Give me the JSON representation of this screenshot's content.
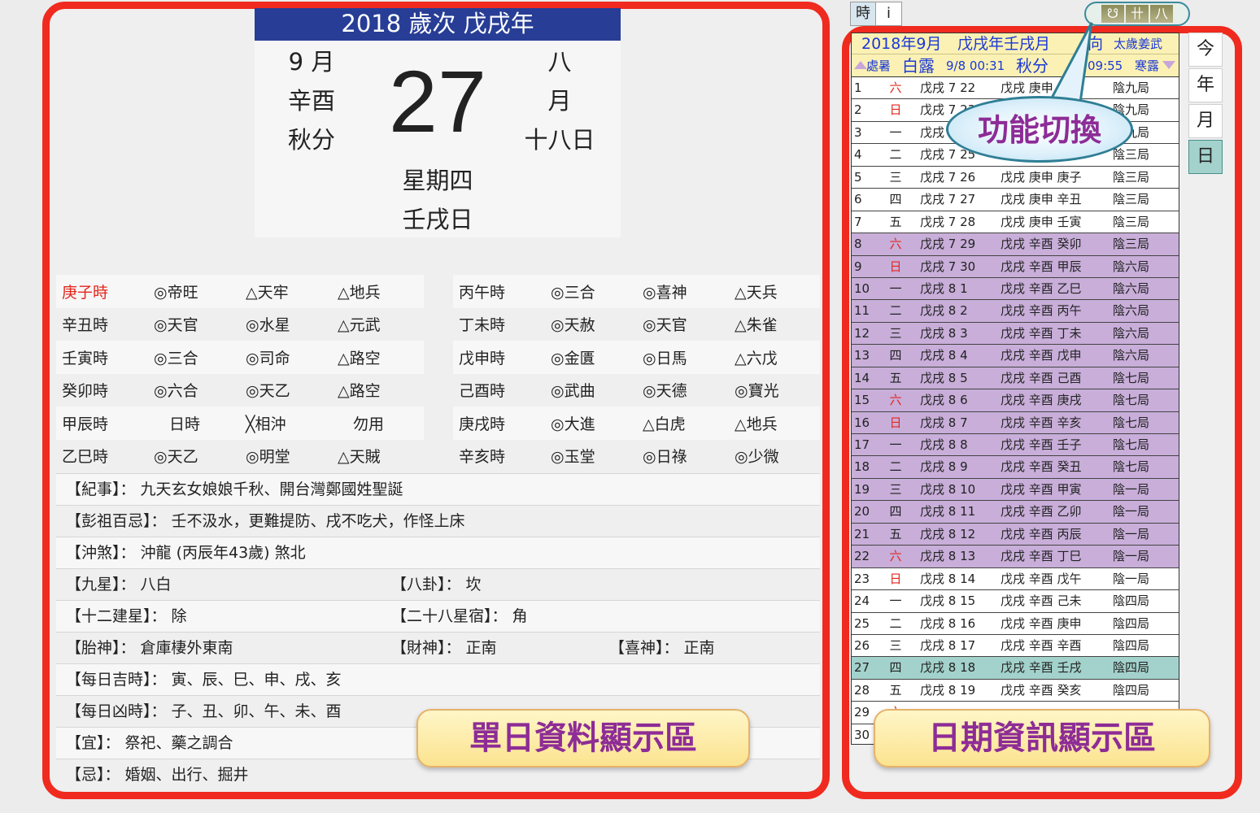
{
  "day_card": {
    "header": "2018 歲次 戊戌年",
    "greg_month": "9 月",
    "month_ganzhi": "辛酉",
    "solar_term": "秋分",
    "day": "27",
    "lunar_month_1": "八",
    "lunar_month_2": "月",
    "lunar_day": "十八日",
    "weekday": "星期四",
    "day_ganzhi": "壬戌日"
  },
  "hours_left": [
    [
      "庚子時",
      "◎帝旺",
      "△天牢",
      "△地兵"
    ],
    [
      "辛丑時",
      "◎天官",
      "◎水星",
      "△元武"
    ],
    [
      "壬寅時",
      "◎三合",
      "◎司命",
      "△路空"
    ],
    [
      "癸卯時",
      "◎六合",
      "◎天乙",
      "△路空"
    ],
    [
      "甲辰時",
      "　日時",
      "╳相沖",
      "　勿用"
    ],
    [
      "乙巳時",
      "◎天乙",
      "◎明堂",
      "△天賊"
    ]
  ],
  "hours_right": [
    [
      "丙午時",
      "◎三合",
      "◎喜神",
      "△天兵"
    ],
    [
      "丁未時",
      "◎天赦",
      "◎天官",
      "△朱雀"
    ],
    [
      "戊申時",
      "◎金匱",
      "◎日馬",
      "△六戊"
    ],
    [
      "己酉時",
      "◎武曲",
      "◎天德",
      "◎寶光"
    ],
    [
      "庚戌時",
      "◎大進",
      "△白虎",
      "△地兵"
    ],
    [
      "辛亥時",
      "◎玉堂",
      "◎日祿",
      "◎少微"
    ]
  ],
  "info": [
    [
      "【紀事】： 九天玄女娘娘千秋、開台灣鄭國姓聖誕",
      "",
      ""
    ],
    [
      "【彭祖百忌】： 壬不汲水，更難提防、戌不吃犬，作怪上床",
      "",
      ""
    ],
    [
      "【沖煞】： 沖龍 (丙辰年43歲) 煞北",
      "",
      ""
    ],
    [
      "【九星】： 八白",
      "【八卦】： 坎",
      ""
    ],
    [
      "【十二建星】： 除",
      "【二十八星宿】： 角",
      ""
    ],
    [
      "【胎神】： 倉庫棲外東南",
      "【財神】： 正南",
      "【喜神】： 正南"
    ],
    [
      "【每日吉時】： 寅、辰、巳、申、戌、亥",
      "",
      ""
    ],
    [
      "【每日凶時】： 子、丑、卯、午、未、酉",
      "",
      ""
    ],
    [
      "【宜】： 祭祀、藥之調合",
      "",
      ""
    ],
    [
      "【忌】： 婚姻、出行、掘井",
      "",
      ""
    ]
  ],
  "labels": {
    "left_area": "單日資料顯示區",
    "right_area": "日期資訊顯示區",
    "callout": "功能切換"
  },
  "top_buttons": [
    "時",
    "i"
  ],
  "icon_pill": [
    "☋",
    "卄",
    "八"
  ],
  "side_buttons": [
    "今",
    "年",
    "月",
    "日"
  ],
  "month_header": {
    "line1_a": "2018年9月",
    "line1_b": "戊戌年壬戌月",
    "line1_c": "向",
    "line1_d": "太歲姜武",
    "line2_a": "處暑",
    "line2_b": "白露",
    "line2_c": "9/8 00:31",
    "line2_d": "秋分",
    "line2_e": "09:55",
    "line2_f": "寒露"
  },
  "month_rows": [
    {
      "d": "1",
      "w": "六",
      "l": "戊戌 7 22",
      "g": "戊戌 庚申 庚辰",
      "j": "陰九局",
      "bg": "white",
      "red": true
    },
    {
      "d": "2",
      "w": "日",
      "l": "戊戌 7 23",
      "g": "戊戌 庚申 辛巳",
      "j": "陰九局",
      "bg": "white",
      "red": true
    },
    {
      "d": "3",
      "w": "一",
      "l": "戊戌 7 24",
      "g": "戊戌 庚申 壬午",
      "j": "陰九局",
      "bg": "white",
      "red": false
    },
    {
      "d": "4",
      "w": "二",
      "l": "戊戌 7 25",
      "g": "戊戌 庚申 癸未",
      "j": "陰三局",
      "bg": "white",
      "red": false
    },
    {
      "d": "5",
      "w": "三",
      "l": "戊戌 7 26",
      "g": "戊戌 庚申 庚子",
      "j": "陰三局",
      "bg": "white",
      "red": false
    },
    {
      "d": "6",
      "w": "四",
      "l": "戊戌 7 27",
      "g": "戊戌 庚申 辛丑",
      "j": "陰三局",
      "bg": "white",
      "red": false
    },
    {
      "d": "7",
      "w": "五",
      "l": "戊戌 7 28",
      "g": "戊戌 庚申 壬寅",
      "j": "陰三局",
      "bg": "white",
      "red": false
    },
    {
      "d": "8",
      "w": "六",
      "l": "戊戌 7 29",
      "g": "戊戌 辛酉 癸卯",
      "j": "陰三局",
      "bg": "purple",
      "red": true
    },
    {
      "d": "9",
      "w": "日",
      "l": "戊戌 7 30",
      "g": "戊戌 辛酉 甲辰",
      "j": "陰六局",
      "bg": "purple",
      "red": true
    },
    {
      "d": "10",
      "w": "一",
      "l": "戊戌 8 1",
      "g": "戊戌 辛酉 乙巳",
      "j": "陰六局",
      "bg": "purple",
      "red": false
    },
    {
      "d": "11",
      "w": "二",
      "l": "戊戌 8 2",
      "g": "戊戌 辛酉 丙午",
      "j": "陰六局",
      "bg": "purple",
      "red": false
    },
    {
      "d": "12",
      "w": "三",
      "l": "戊戌 8 3",
      "g": "戊戌 辛酉 丁未",
      "j": "陰六局",
      "bg": "purple",
      "red": false
    },
    {
      "d": "13",
      "w": "四",
      "l": "戊戌 8 4",
      "g": "戊戌 辛酉 戊申",
      "j": "陰六局",
      "bg": "purple",
      "red": false
    },
    {
      "d": "14",
      "w": "五",
      "l": "戊戌 8 5",
      "g": "戊戌 辛酉 己酉",
      "j": "陰七局",
      "bg": "purple",
      "red": false
    },
    {
      "d": "15",
      "w": "六",
      "l": "戊戌 8 6",
      "g": "戊戌 辛酉 庚戌",
      "j": "陰七局",
      "bg": "purple",
      "red": true
    },
    {
      "d": "16",
      "w": "日",
      "l": "戊戌 8 7",
      "g": "戊戌 辛酉 辛亥",
      "j": "陰七局",
      "bg": "purple",
      "red": true
    },
    {
      "d": "17",
      "w": "一",
      "l": "戊戌 8 8",
      "g": "戊戌 辛酉 壬子",
      "j": "陰七局",
      "bg": "purple",
      "red": false
    },
    {
      "d": "18",
      "w": "二",
      "l": "戊戌 8 9",
      "g": "戊戌 辛酉 癸丑",
      "j": "陰七局",
      "bg": "purple",
      "red": false
    },
    {
      "d": "19",
      "w": "三",
      "l": "戊戌 8 10",
      "g": "戊戌 辛酉 甲寅",
      "j": "陰一局",
      "bg": "purple",
      "red": false
    },
    {
      "d": "20",
      "w": "四",
      "l": "戊戌 8 11",
      "g": "戊戌 辛酉 乙卯",
      "j": "陰一局",
      "bg": "purple",
      "red": false
    },
    {
      "d": "21",
      "w": "五",
      "l": "戊戌 8 12",
      "g": "戊戌 辛酉 丙辰",
      "j": "陰一局",
      "bg": "purple",
      "red": false
    },
    {
      "d": "22",
      "w": "六",
      "l": "戊戌 8 13",
      "g": "戊戌 辛酉 丁巳",
      "j": "陰一局",
      "bg": "purple",
      "red": true
    },
    {
      "d": "23",
      "w": "日",
      "l": "戊戌 8 14",
      "g": "戊戌 辛酉 戊午",
      "j": "陰一局",
      "bg": "white",
      "red": true
    },
    {
      "d": "24",
      "w": "一",
      "l": "戊戌 8 15",
      "g": "戊戌 辛酉 己未",
      "j": "陰四局",
      "bg": "white",
      "red": false
    },
    {
      "d": "25",
      "w": "二",
      "l": "戊戌 8 16",
      "g": "戊戌 辛酉 庚申",
      "j": "陰四局",
      "bg": "white",
      "red": false
    },
    {
      "d": "26",
      "w": "三",
      "l": "戊戌 8 17",
      "g": "戊戌 辛酉 辛酉",
      "j": "陰四局",
      "bg": "white",
      "red": false
    },
    {
      "d": "27",
      "w": "四",
      "l": "戊戌 8 18",
      "g": "戊戌 辛酉 壬戌",
      "j": "陰四局",
      "bg": "teal",
      "red": false
    },
    {
      "d": "28",
      "w": "五",
      "l": "戊戌 8 19",
      "g": "戊戌 辛酉 癸亥",
      "j": "陰四局",
      "bg": "white",
      "red": false
    },
    {
      "d": "29",
      "w": "六",
      "l": "",
      "g": "",
      "j": "",
      "bg": "white",
      "red": true
    },
    {
      "d": "30",
      "w": "",
      "l": "",
      "g": "",
      "j": "",
      "bg": "white",
      "red": false
    }
  ]
}
